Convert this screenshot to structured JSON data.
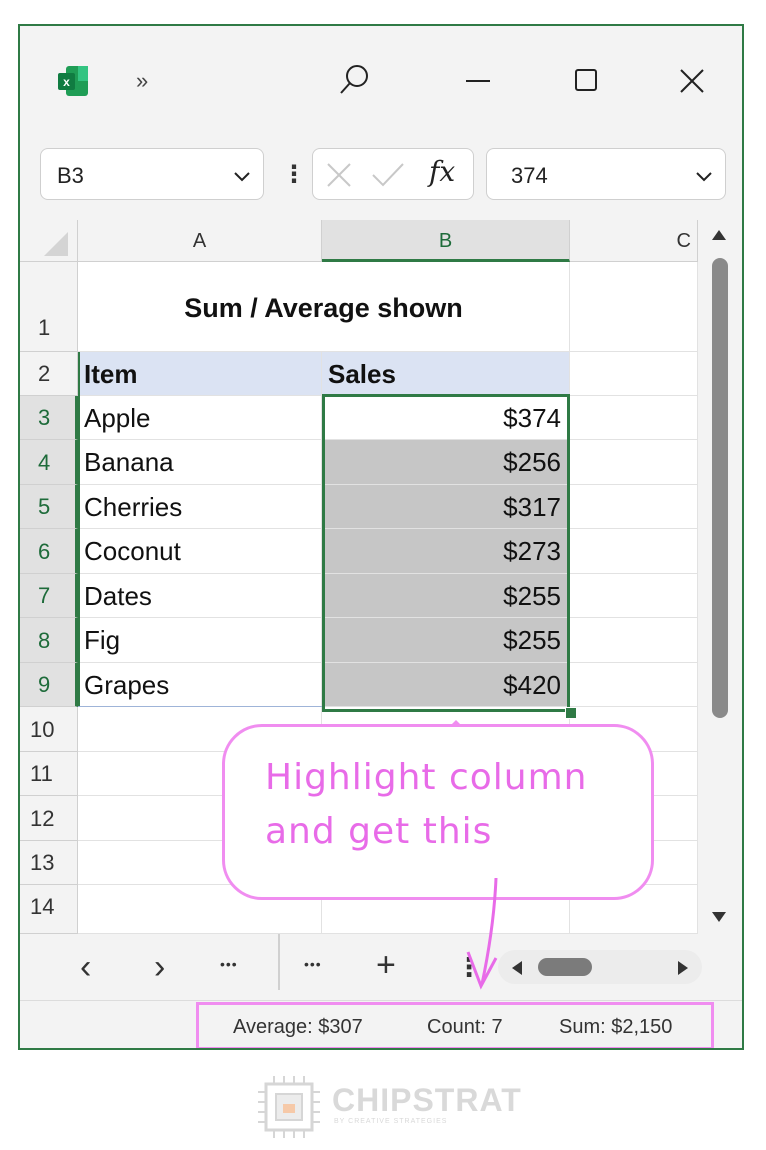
{
  "window": {
    "namebox": "B3",
    "formula_value": "374",
    "fx_label": "fx"
  },
  "columns": [
    "A",
    "B",
    "C"
  ],
  "rows": [
    "1",
    "2",
    "3",
    "4",
    "5",
    "6",
    "7",
    "8",
    "9",
    "10",
    "11",
    "12",
    "13",
    "14"
  ],
  "sheet": {
    "title": "Sum / Average  shown",
    "header": {
      "item": "Item",
      "sales": "Sales"
    },
    "data": [
      {
        "item": "Apple",
        "sales": "$374"
      },
      {
        "item": "Banana",
        "sales": "$256"
      },
      {
        "item": "Cherries",
        "sales": "$317"
      },
      {
        "item": "Coconut",
        "sales": "$273"
      },
      {
        "item": "Dates",
        "sales": "$255"
      },
      {
        "item": "Fig",
        "sales": "$255"
      },
      {
        "item": "Grapes",
        "sales": "$420"
      }
    ]
  },
  "tabs_bar": {
    "prev": "‹",
    "next": "›",
    "more_left": "•••",
    "more_right": "•••",
    "add": "+"
  },
  "status_bar": {
    "average": "Average: $307",
    "count": "Count: 7",
    "sum": "Sum: $2,150"
  },
  "callout": {
    "line1": "Highlight column",
    "line2": "and get this"
  },
  "footer": {
    "brand": "CHIPSTRAT",
    "tagline": "BY CREATIVE STRATEGIES"
  },
  "colors": {
    "accent_green": "#2f7a45",
    "annotation_pink": "#f08df0",
    "header_fill": "#dbe3f3",
    "selection_fill": "#c6c6c6"
  }
}
